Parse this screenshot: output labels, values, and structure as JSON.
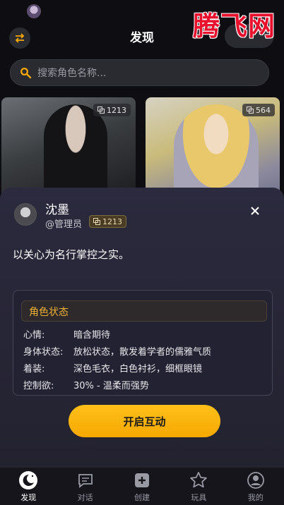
{
  "header": {
    "title": "发现"
  },
  "watermark": "腾飞网",
  "search": {
    "placeholder": "搜索角色名称..."
  },
  "cards": [
    {
      "count": "1213"
    },
    {
      "count": "564"
    }
  ],
  "sheet": {
    "name": "沈墨",
    "creator": "@管理员",
    "count": "1213",
    "quote": "以关心为名行掌控之实。",
    "status": {
      "title": "角色状态",
      "rows": [
        {
          "key": "心情:",
          "value": "暗含期待"
        },
        {
          "key": "身体状态:",
          "value": "放松状态，散发着学者的儒雅气质"
        },
        {
          "key": "着装:",
          "value": "深色毛衣，白色衬衫，细框眼镜"
        },
        {
          "key": "控制欲:",
          "value": "30% - 温柔而强势"
        }
      ]
    },
    "start_button": "开启互动"
  },
  "tabs": [
    {
      "label": "发现",
      "icon": "moon-icon",
      "active": true
    },
    {
      "label": "对话",
      "icon": "chat-icon",
      "active": false
    },
    {
      "label": "创建",
      "icon": "plus-icon",
      "active": false
    },
    {
      "label": "玩具",
      "icon": "star-icon",
      "active": false
    },
    {
      "label": "我的",
      "icon": "profile-icon",
      "active": false
    }
  ],
  "colors": {
    "accent": "#f5a800",
    "watermark": "#e8112d",
    "sheet_bg": "#2b2a3e"
  }
}
